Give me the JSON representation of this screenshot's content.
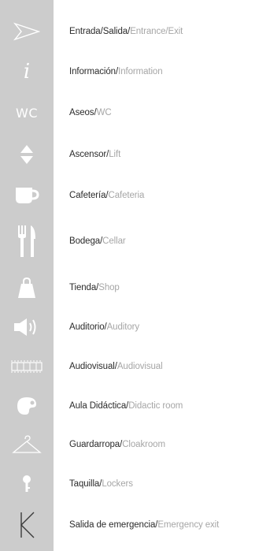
{
  "separator": "/",
  "colors": {
    "strip": "#cccccc",
    "icon": "#ffffff",
    "spanish": "#2b2b2b",
    "english": "#a6a6a6"
  },
  "items": [
    {
      "icon": "entrance-arrow-icon",
      "es": "Entrada",
      "en": "Entrance/Exit",
      "pre": "Salida"
    },
    {
      "icon": "info-icon",
      "glyph": "i",
      "es": "Información",
      "en": "Information"
    },
    {
      "icon": "wc-icon",
      "glyph": "WC",
      "es": "Aseos",
      "en": "WC"
    },
    {
      "icon": "lift-icon",
      "es": "Ascensor",
      "en": "Lift"
    },
    {
      "icon": "coffee-cup-icon",
      "es": "Cafetería",
      "en": "Cafeteria"
    },
    {
      "icon": "fork-knife-icon",
      "es": "Bodega",
      "en": "Cellar"
    },
    {
      "icon": "shopping-bag-icon",
      "es": "Tienda",
      "en": "Shop"
    },
    {
      "icon": "speaker-icon",
      "es": "Auditorio",
      "en": "Auditory"
    },
    {
      "icon": "film-strip-icon",
      "es": "Audiovisual",
      "en": "Audiovisual"
    },
    {
      "icon": "palette-icon",
      "es": "Aula Didáctica",
      "en": "Didactic room"
    },
    {
      "icon": "hanger-icon",
      "es": "Guardarropa",
      "en": "Cloakroom"
    },
    {
      "icon": "key-icon",
      "es": "Taquilla",
      "en": "Lockers"
    },
    {
      "icon": "emergency-exit-icon",
      "es": "Salida de emergencia",
      "en": "Emergency exit"
    }
  ]
}
